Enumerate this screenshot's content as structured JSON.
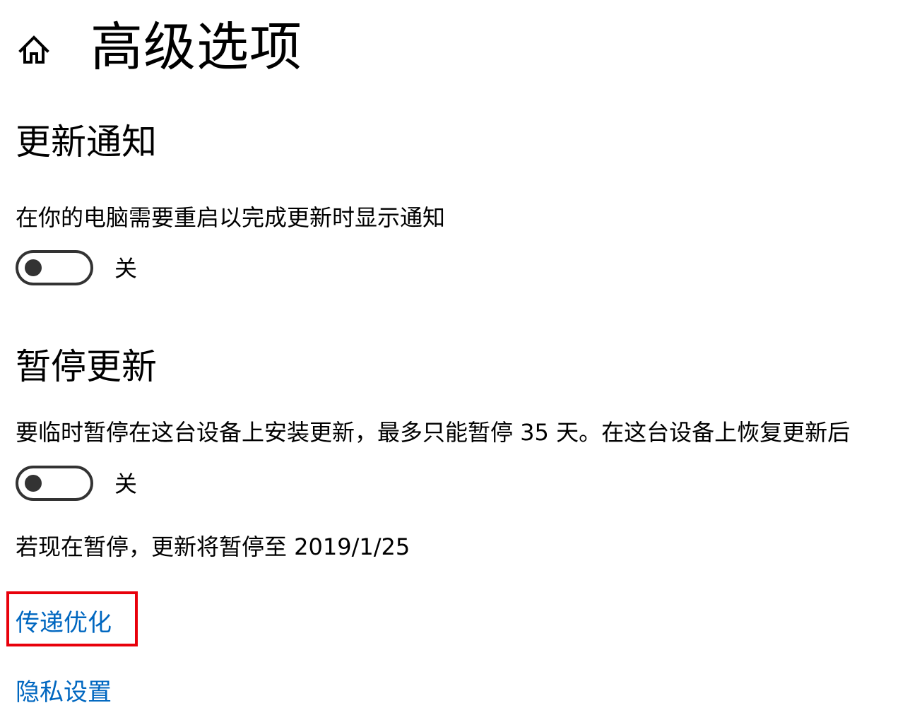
{
  "header": {
    "title": "高级选项",
    "home_icon": "home-icon"
  },
  "update_notifications": {
    "title": "更新通知",
    "description": "在你的电脑需要重启以完成更新时显示通知",
    "toggle_state": "关",
    "toggle_on": false
  },
  "pause_updates": {
    "title": "暂停更新",
    "description": "要临时暂停在这台设备上安装更新，最多只能暂停 35 天。在这台设备上恢复更新后",
    "toggle_state": "关",
    "toggle_on": false,
    "pause_until_text": "若现在暂停，更新将暂停至 2019/1/25"
  },
  "links": {
    "delivery_optimization": "传递优化",
    "privacy_settings": "隐私设置"
  },
  "colors": {
    "link": "#0067c0",
    "highlight": "#e8000b",
    "toggle": "#333333"
  }
}
